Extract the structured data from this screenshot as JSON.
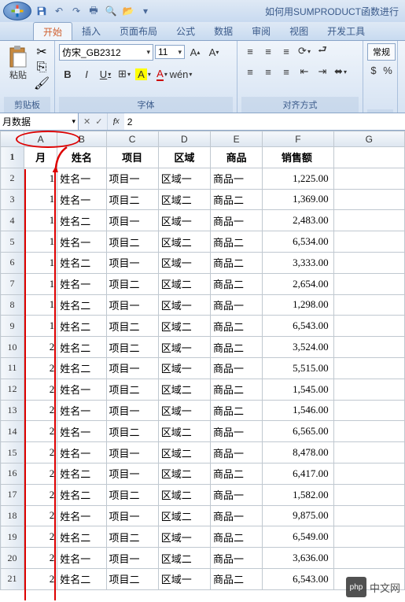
{
  "title": "如何用SUMPRODUCT函数进行",
  "tabs": [
    "开始",
    "插入",
    "页面布局",
    "公式",
    "数据",
    "审阅",
    "视图",
    "开发工具"
  ],
  "active_tab": 0,
  "ribbon": {
    "clipboard": {
      "label": "剪贴板",
      "paste": "粘贴"
    },
    "font": {
      "label": "字体",
      "name": "仿宋_GB2312",
      "size": "11",
      "bold": "B",
      "italic": "I",
      "underline": "U"
    },
    "align": {
      "label": "对齐方式"
    },
    "number": {
      "label": "常规"
    }
  },
  "namebox": "月数据",
  "formula": "2",
  "columns": [
    "A",
    "B",
    "C",
    "D",
    "E",
    "F",
    "G"
  ],
  "header_row": [
    "月",
    "姓名",
    "项目",
    "区域",
    "商品",
    "销售额",
    ""
  ],
  "rows": [
    [
      "1",
      "姓名一",
      "项目一",
      "区域一",
      "商品一",
      "1,225.00"
    ],
    [
      "1",
      "姓名一",
      "项目二",
      "区域二",
      "商品二",
      "1,369.00"
    ],
    [
      "1",
      "姓名二",
      "项目一",
      "区域一",
      "商品一",
      "2,483.00"
    ],
    [
      "1",
      "姓名一",
      "项目二",
      "区域二",
      "商品二",
      "6,534.00"
    ],
    [
      "1",
      "姓名二",
      "项目一",
      "区域一",
      "商品二",
      "3,333.00"
    ],
    [
      "1",
      "姓名一",
      "项目二",
      "区域二",
      "商品二",
      "2,654.00"
    ],
    [
      "1",
      "姓名二",
      "项目一",
      "区域一",
      "商品一",
      "1,298.00"
    ],
    [
      "1",
      "姓名二",
      "项目二",
      "区域二",
      "商品二",
      "6,543.00"
    ],
    [
      "2",
      "姓名二",
      "项目二",
      "区域一",
      "商品二",
      "3,524.00"
    ],
    [
      "2",
      "姓名二",
      "项目一",
      "区域一",
      "商品一",
      "5,515.00"
    ],
    [
      "2",
      "姓名一",
      "项目二",
      "区域二",
      "商品二",
      "1,545.00"
    ],
    [
      "2",
      "姓名一",
      "项目一",
      "区域一",
      "商品二",
      "1,546.00"
    ],
    [
      "2",
      "姓名一",
      "项目二",
      "区域二",
      "商品一",
      "6,565.00"
    ],
    [
      "2",
      "姓名一",
      "项目一",
      "区域二",
      "商品一",
      "8,478.00"
    ],
    [
      "2",
      "姓名二",
      "项目一",
      "区域二",
      "商品二",
      "6,417.00"
    ],
    [
      "2",
      "姓名二",
      "项目二",
      "区域二",
      "商品一",
      "1,582.00"
    ],
    [
      "2",
      "姓名一",
      "项目一",
      "区域二",
      "商品一",
      "9,875.00"
    ],
    [
      "2",
      "姓名二",
      "项目二",
      "区域一",
      "商品二",
      "6,549.00"
    ],
    [
      "2",
      "姓名一",
      "项目一",
      "区域二",
      "商品一",
      "3,636.00"
    ],
    [
      "2",
      "姓名二",
      "项目二",
      "区域一",
      "商品二",
      "6,543.00"
    ]
  ],
  "watermark": {
    "logo": "php",
    "text": "中文网"
  }
}
